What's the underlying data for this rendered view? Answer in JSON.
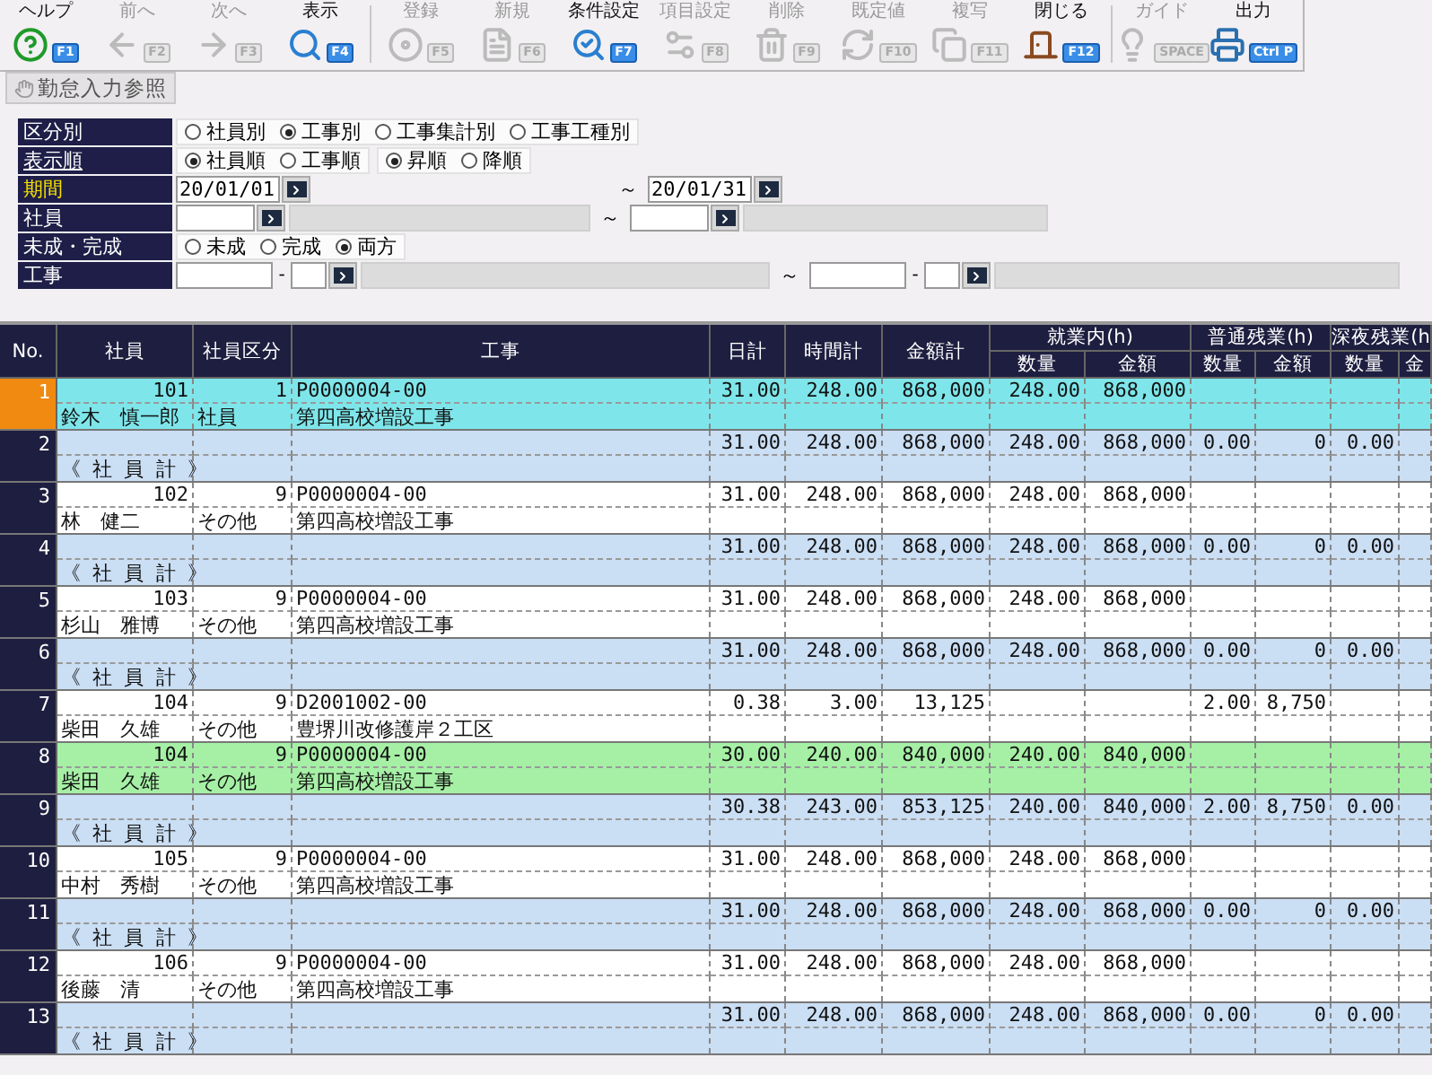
{
  "toolbar": {
    "groups": [
      [
        {
          "label": "ヘルプ",
          "key": "F1",
          "enabled": true
        },
        {
          "label": "前へ",
          "key": "F2",
          "enabled": false
        },
        {
          "label": "次へ",
          "key": "F3",
          "enabled": false
        },
        {
          "label": "表示",
          "key": "F4",
          "enabled": true
        }
      ],
      [
        {
          "label": "登録",
          "key": "F5",
          "enabled": false
        },
        {
          "label": "新規",
          "key": "F6",
          "enabled": false
        },
        {
          "label": "条件設定",
          "key": "F7",
          "enabled": true
        },
        {
          "label": "項目設定",
          "key": "F8",
          "enabled": false
        },
        {
          "label": "削除",
          "key": "F9",
          "enabled": false
        },
        {
          "label": "既定値",
          "key": "F10",
          "enabled": false
        },
        {
          "label": "複写",
          "key": "F11",
          "enabled": false
        },
        {
          "label": "閉じる",
          "key": "F12",
          "enabled": true
        }
      ],
      [
        {
          "label": "ガイド",
          "key": "SPACE",
          "enabled": false
        },
        {
          "label": "出力",
          "key": "Ctrl P",
          "enabled": true
        }
      ]
    ]
  },
  "reference_button": {
    "label": "勤怠入力参照"
  },
  "filters": [
    {
      "label": "区分別",
      "required": false,
      "underlined": false,
      "kind": "radios",
      "groups": [
        [
          {
            "label": "社員別",
            "selected": false
          },
          {
            "label": "工事別",
            "selected": true
          },
          {
            "label": "工事集計別",
            "selected": false
          },
          {
            "label": "工事工種別",
            "selected": false
          }
        ]
      ]
    },
    {
      "label": "表示順",
      "required": false,
      "underlined": true,
      "kind": "radios",
      "groups": [
        [
          {
            "label": "社員順",
            "selected": true
          },
          {
            "label": "工事順",
            "selected": false
          }
        ],
        [
          {
            "label": "昇順",
            "selected": true
          },
          {
            "label": "降順",
            "selected": false
          }
        ]
      ]
    },
    {
      "label": "期間",
      "required": true,
      "underlined": false,
      "kind": "date_range",
      "from": "20/01/01",
      "separator": "～",
      "to": "20/01/31"
    },
    {
      "label": "社員",
      "required": false,
      "underlined": false,
      "kind": "code_range",
      "separator": "～"
    },
    {
      "label": "未成・完成",
      "required": false,
      "underlined": false,
      "kind": "radios",
      "groups": [
        [
          {
            "label": "未成",
            "selected": false
          },
          {
            "label": "完成",
            "selected": false
          },
          {
            "label": "両方",
            "selected": true
          }
        ]
      ]
    },
    {
      "label": "工事",
      "required": false,
      "underlined": false,
      "kind": "split_code_range",
      "dash": "-",
      "separator": "～"
    }
  ],
  "table": {
    "columns": [
      {
        "label": "No."
      },
      {
        "label": "社員"
      },
      {
        "label": "社員区分"
      },
      {
        "label": "工事"
      },
      {
        "label": "日計"
      },
      {
        "label": "時間計"
      },
      {
        "label": "金額計"
      },
      {
        "label": "就業内(h)",
        "children": [
          "数量",
          "金額"
        ]
      },
      {
        "label": "普通残業(h)",
        "children": [
          "数量",
          "金額"
        ]
      },
      {
        "label": "深夜残業(h",
        "children": [
          "数量",
          "金"
        ]
      }
    ],
    "rows": [
      {
        "no": "1",
        "kind": "detail",
        "selected": true,
        "color": "#7ee6ea",
        "employee_code": "101",
        "employee_name": "鈴木　慎一郎",
        "class_code": "1",
        "class_name": "社員",
        "job_code": "P0000004-00",
        "job_name": "第四高校増設工事",
        "days": "31.00",
        "hours": "248.00",
        "amount": "868,000",
        "regular_qty": "248.00",
        "regular_amt": "868,000"
      },
      {
        "no": "2",
        "kind": "subtotal",
        "selected": false,
        "color": "#cadef4",
        "label": "《 社 員 計 》",
        "days": "31.00",
        "hours": "248.00",
        "amount": "868,000",
        "regular_qty": "248.00",
        "regular_amt": "868,000",
        "overtime_qty": "0.00",
        "overtime_amt": "0",
        "night_qty": "0.00"
      },
      {
        "no": "3",
        "kind": "detail",
        "selected": false,
        "color": "#ffffff",
        "employee_code": "102",
        "employee_name": "林　健二",
        "class_code": "9",
        "class_name": "その他",
        "job_code": "P0000004-00",
        "job_name": "第四高校増設工事",
        "days": "31.00",
        "hours": "248.00",
        "amount": "868,000",
        "regular_qty": "248.00",
        "regular_amt": "868,000"
      },
      {
        "no": "4",
        "kind": "subtotal",
        "selected": false,
        "color": "#cadef4",
        "label": "《 社 員 計 》",
        "days": "31.00",
        "hours": "248.00",
        "amount": "868,000",
        "regular_qty": "248.00",
        "regular_amt": "868,000",
        "overtime_qty": "0.00",
        "overtime_amt": "0",
        "night_qty": "0.00"
      },
      {
        "no": "5",
        "kind": "detail",
        "selected": false,
        "color": "#ffffff",
        "employee_code": "103",
        "employee_name": "杉山　雅博",
        "class_code": "9",
        "class_name": "その他",
        "job_code": "P0000004-00",
        "job_name": "第四高校増設工事",
        "days": "31.00",
        "hours": "248.00",
        "amount": "868,000",
        "regular_qty": "248.00",
        "regular_amt": "868,000"
      },
      {
        "no": "6",
        "kind": "subtotal",
        "selected": false,
        "color": "#cadef4",
        "label": "《 社 員 計 》",
        "days": "31.00",
        "hours": "248.00",
        "amount": "868,000",
        "regular_qty": "248.00",
        "regular_amt": "868,000",
        "overtime_qty": "0.00",
        "overtime_amt": "0",
        "night_qty": "0.00"
      },
      {
        "no": "7",
        "kind": "detail",
        "selected": false,
        "color": "#ffffff",
        "employee_code": "104",
        "employee_name": "柴田　久雄",
        "class_code": "9",
        "class_name": "その他",
        "job_code": "D2001002-00",
        "job_name": "豊堺川改修護岸２工区",
        "days": "0.38",
        "hours": "3.00",
        "amount": "13,125",
        "overtime_qty": "2.00",
        "overtime_amt": "8,750"
      },
      {
        "no": "8",
        "kind": "detail",
        "selected": false,
        "color": "#a6f0a6",
        "employee_code": "104",
        "employee_name": "柴田　久雄",
        "class_code": "9",
        "class_name": "その他",
        "job_code": "P0000004-00",
        "job_name": "第四高校増設工事",
        "days": "30.00",
        "hours": "240.00",
        "amount": "840,000",
        "regular_qty": "240.00",
        "regular_amt": "840,000"
      },
      {
        "no": "9",
        "kind": "subtotal",
        "selected": false,
        "color": "#cadef4",
        "label": "《 社 員 計 》",
        "days": "30.38",
        "hours": "243.00",
        "amount": "853,125",
        "regular_qty": "240.00",
        "regular_amt": "840,000",
        "overtime_qty": "2.00",
        "overtime_amt": "8,750",
        "night_qty": "0.00"
      },
      {
        "no": "10",
        "kind": "detail",
        "selected": false,
        "color": "#ffffff",
        "employee_code": "105",
        "employee_name": "中村　秀樹",
        "class_code": "9",
        "class_name": "その他",
        "job_code": "P0000004-00",
        "job_name": "第四高校増設工事",
        "days": "31.00",
        "hours": "248.00",
        "amount": "868,000",
        "regular_qty": "248.00",
        "regular_amt": "868,000"
      },
      {
        "no": "11",
        "kind": "subtotal",
        "selected": false,
        "color": "#cadef4",
        "label": "《 社 員 計 》",
        "days": "31.00",
        "hours": "248.00",
        "amount": "868,000",
        "regular_qty": "248.00",
        "regular_amt": "868,000",
        "overtime_qty": "0.00",
        "overtime_amt": "0",
        "night_qty": "0.00"
      },
      {
        "no": "12",
        "kind": "detail",
        "selected": false,
        "color": "#ffffff",
        "employee_code": "106",
        "employee_name": "後藤　清",
        "class_code": "9",
        "class_name": "その他",
        "job_code": "P0000004-00",
        "job_name": "第四高校増設工事",
        "days": "31.00",
        "hours": "248.00",
        "amount": "868,000",
        "regular_qty": "248.00",
        "regular_amt": "868,000"
      },
      {
        "no": "13",
        "kind": "subtotal",
        "selected": false,
        "color": "#cadef4",
        "label": "《 社 員 計 》",
        "days": "31.00",
        "hours": "248.00",
        "amount": "868,000",
        "regular_qty": "248.00",
        "regular_amt": "868,000",
        "overtime_qty": "0.00",
        "overtime_amt": "0",
        "night_qty": "0.00"
      }
    ]
  }
}
